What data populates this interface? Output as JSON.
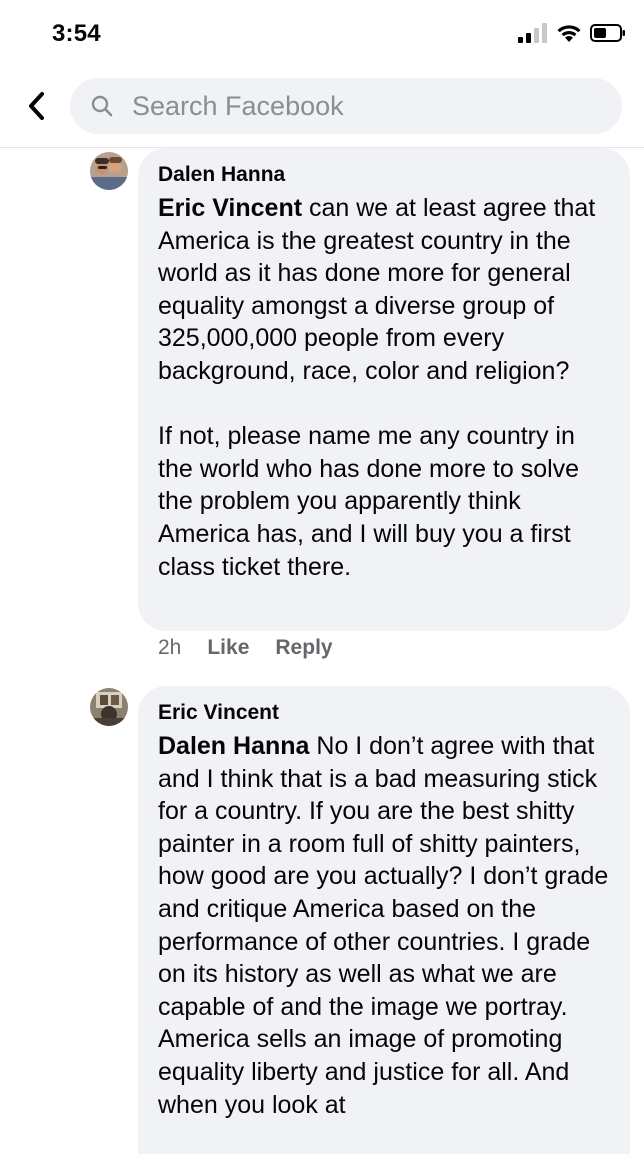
{
  "status_bar": {
    "time": "3:54"
  },
  "header": {
    "search_placeholder": "Search Facebook"
  },
  "comments": [
    {
      "author": "Dalen Hanna",
      "mention": "Eric Vincent",
      "paragraph1": " can we at least agree that America is the greatest country in the world as it has done more for general equality amongst a diverse group of 325,000,000 people from every background, race, color and religion?",
      "paragraph2": "If not, please name me any country in the world who has done more to solve the problem you apparently think America has, and I will buy you a first class ticket there.",
      "time": "2h",
      "like_label": "Like",
      "reply_label": "Reply"
    },
    {
      "author": "Eric Vincent",
      "mention": "Dalen Hanna",
      "paragraph1": " No I don’t agree with that and I think that is a bad measuring stick for a country. If you are the best shitty painter in a room full of shitty painters, how good are you actually? I don’t grade and critique America based on the performance of other countries. I grade on its history as well as what we are capable of and the image we portray. America sells an image of promoting equality liberty and justice for all. And when you look at"
    }
  ]
}
